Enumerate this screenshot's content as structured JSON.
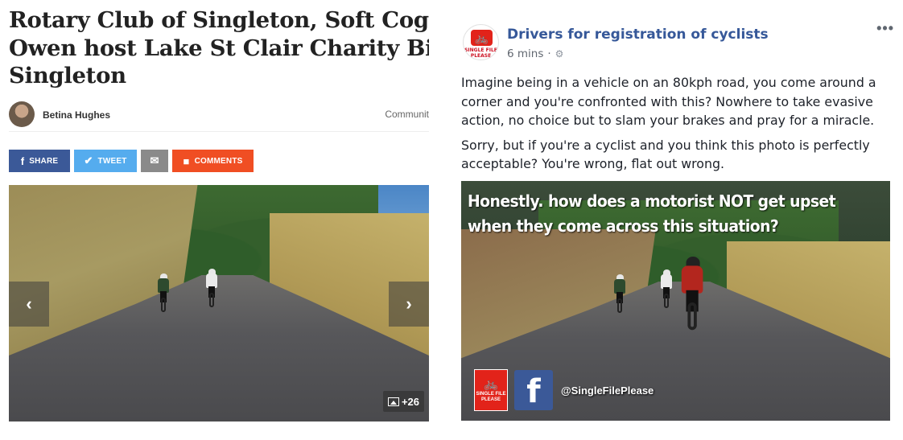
{
  "article": {
    "headline_lines": [
      "Rotary Club of Singleton, Soft Cogs I",
      "Owen host Lake St Clair Charity Bike",
      "Singleton"
    ],
    "author": "Betina Hughes",
    "section": "Communit",
    "share": {
      "facebook_label": "SHARE",
      "twitter_label": "TWEET",
      "comments_label": "COMMENTS",
      "facebook_icon": "f",
      "twitter_icon": "✔",
      "mail_icon": "✉",
      "comments_icon": "■"
    },
    "gallery": {
      "prev_icon": "‹",
      "next_icon": "›",
      "photo_count": "+26"
    }
  },
  "post": {
    "page_name": "Drivers for registration of cyclists",
    "time": "6 mins",
    "separator": "·",
    "more_icon": "•••",
    "logo_text": "SINGLE FILE PLEASE",
    "paragraphs": [
      "Imagine being in a vehicle on an 80kph road, you come around a corner and you're confronted with this? Nowhere to take evasive action, no choice but to slam your brakes and pray for a miracle.",
      "Sorry, but if you're a cyclist and you think this photo is perfectly acceptable? You're wrong, flat out wrong."
    ],
    "image": {
      "caption": "Honestly.  how does a motorist NOT get upset when they come across this situation?",
      "logo_text": "SINGLE FILE PLEASE",
      "fb_letter": "f",
      "handle": "@SingleFilePlease"
    }
  },
  "colors": {
    "facebook_blue": "#3b5998",
    "twitter_blue": "#55acee",
    "comments_orange": "#f04e23",
    "page_link": "#365899",
    "logo_red": "#e2231a"
  }
}
